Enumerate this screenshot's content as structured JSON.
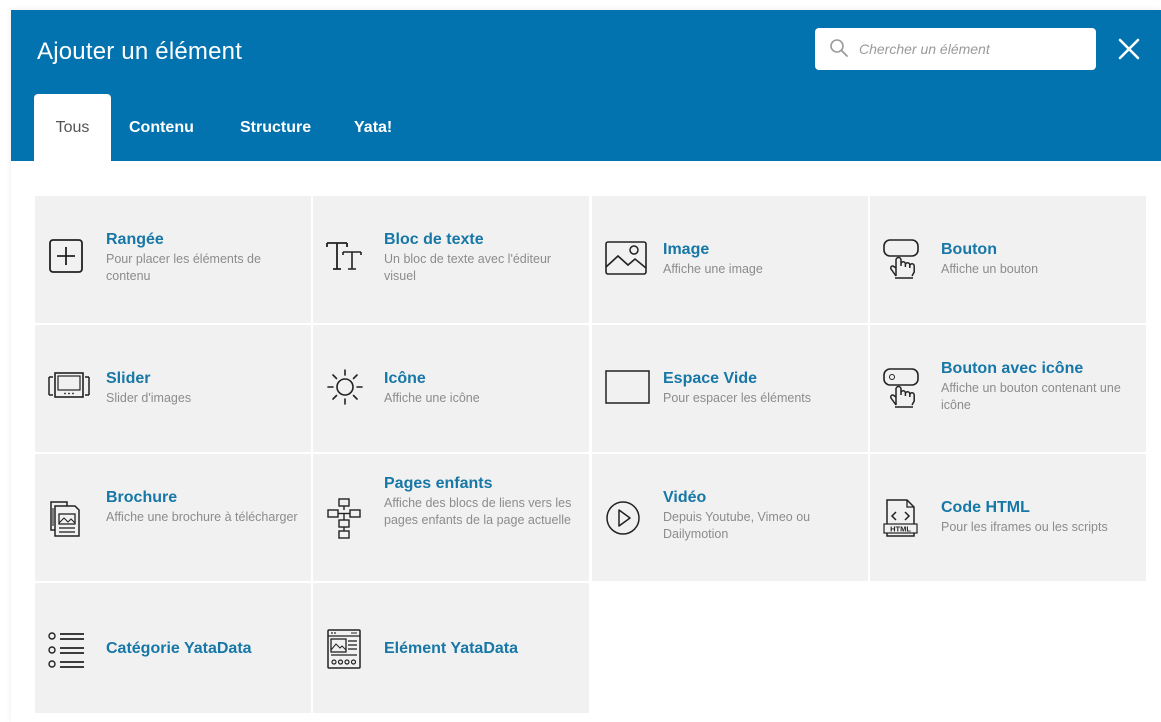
{
  "header": {
    "title": "Ajouter un élément",
    "bg_color": "#0273af"
  },
  "search": {
    "placeholder": "Chercher un élément",
    "icon": "search-icon"
  },
  "close": {
    "icon": "close-icon"
  },
  "tabs": [
    {
      "label": "Tous",
      "active": true
    },
    {
      "label": "Contenu",
      "active": false
    },
    {
      "label": "Structure",
      "active": false
    },
    {
      "label": "Yata!",
      "active": false
    }
  ],
  "elements": [
    {
      "name": "Rangée",
      "description": "Pour placer les éléments de contenu",
      "icon": "plus-box-icon"
    },
    {
      "name": "Bloc de texte",
      "description": "Un bloc de texte avec l'éditeur visuel",
      "icon": "text-icon"
    },
    {
      "name": "Image",
      "description": "Affiche une image",
      "icon": "image-icon"
    },
    {
      "name": "Bouton",
      "description": "Affiche un bouton",
      "icon": "button-hand-icon"
    },
    {
      "name": "Slider",
      "description": "Slider d'images",
      "icon": "slider-icon"
    },
    {
      "name": "Icône",
      "description": "Affiche une icône",
      "icon": "sun-icon"
    },
    {
      "name": "Espace Vide",
      "description": "Pour espacer les éléments",
      "icon": "empty-rectangle-icon"
    },
    {
      "name": "Bouton avec icône",
      "description": "Affiche un bouton contenant une icône",
      "icon": "icon-button-hand-icon"
    },
    {
      "name": "Brochure",
      "description": "Affiche une brochure à télécharger",
      "icon": "brochure-icon"
    },
    {
      "name": "Pages enfants",
      "description": "Affiche des blocs de liens vers les pages enfants de la page actuelle",
      "icon": "sitemap-icon"
    },
    {
      "name": "Vidéo",
      "description": "Depuis Youtube, Vimeo ou Dailymotion",
      "icon": "play-circle-icon"
    },
    {
      "name": "Code HTML",
      "description": "Pour les iframes ou les scripts",
      "icon": "html-code-icon"
    },
    {
      "name": "Catégorie YataData",
      "description": "",
      "icon": "list-icon"
    },
    {
      "name": "Elément YataData",
      "description": "",
      "icon": "data-window-icon"
    }
  ]
}
